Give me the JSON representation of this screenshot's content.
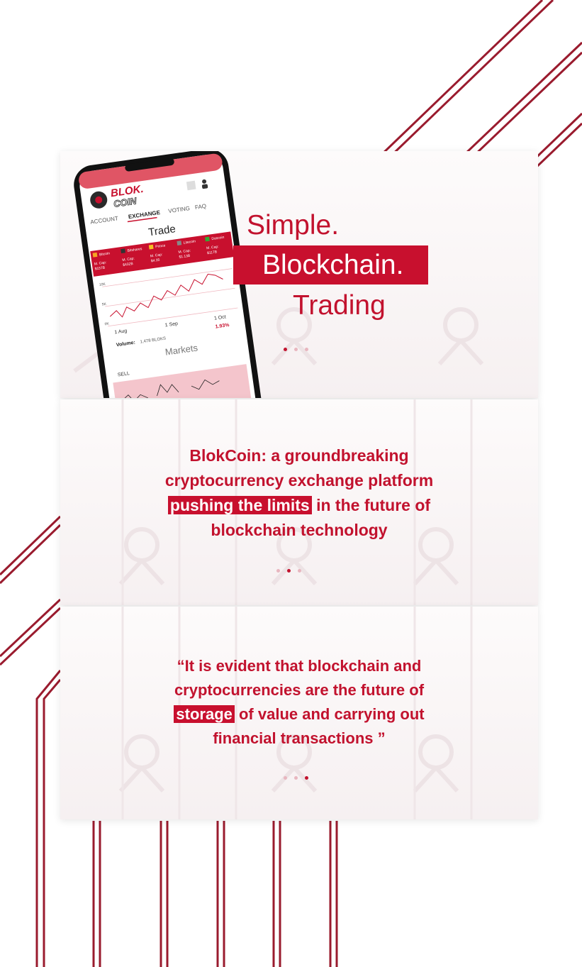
{
  "colors": {
    "accent": "#c2122e",
    "highlight_bg": "#c8102e",
    "line": "#9a1b2e"
  },
  "hero": {
    "line1": "Simple.",
    "line2": "Blockchain.",
    "line3": "Trading"
  },
  "phone": {
    "logo_top": "BLOK.",
    "logo_bottom": "COIN",
    "nav": [
      "ACCOUNT",
      "EXCHANGE",
      "VOTING",
      "FAQ"
    ],
    "search_icon": "search-icon",
    "user_icon": "user-icon",
    "trade_title": "Trade",
    "coins": [
      {
        "name": "Bitcoin",
        "cap_label": "M. Cap:",
        "cap": "$157B"
      },
      {
        "name": "Bitshares",
        "cap_label": "M. Cap:",
        "cap": "$432B"
      },
      {
        "name": "Prince",
        "cap_label": "M. Cap:",
        "cap": "$4.35"
      },
      {
        "name": "Litecoin",
        "cap_label": "M. Cap:",
        "cap": "$1.13B"
      },
      {
        "name": "Dascoin",
        "cap_label": "M. Cap:",
        "cap": "$117B"
      }
    ],
    "chart_x_labels": [
      "1 Aug",
      "1 Sep",
      "1 Oct"
    ],
    "chart_y_labels": [
      "10K",
      "5K",
      "0K"
    ],
    "change": "1.93%",
    "volume_label": "Volume:",
    "volume_value": "1,478 BLOKS",
    "markets_title": "Markets",
    "sell_label": "SELL"
  },
  "section2": {
    "line1": "BlokCoin: a groundbreaking",
    "line2": "cryptocurrency exchange platform",
    "line3_highlight": "pushing the limits",
    "line3_rest": " in the future of",
    "line4": "blockchain technology"
  },
  "section3": {
    "line1": "“It is evident that blockchain and",
    "line2": "cryptocurrencies are the future of",
    "line3_highlight": "storage",
    "line3_rest": " of value and carrying out",
    "line4": "financial transactions ”"
  },
  "carousel": {
    "slide1_active": 1,
    "slide2_active": 2,
    "slide3_active": 3,
    "total": 3
  }
}
